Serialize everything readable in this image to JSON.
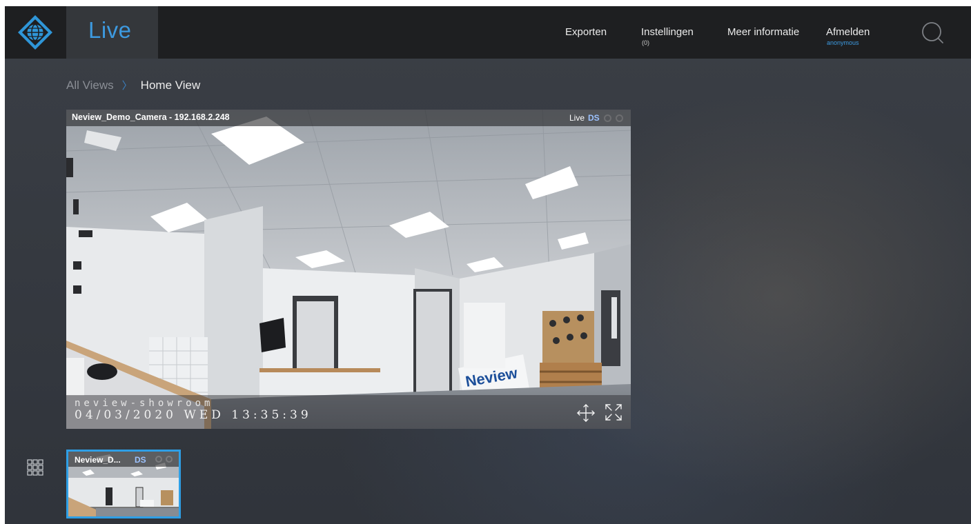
{
  "header": {
    "app_tab": "Live",
    "nav": [
      {
        "label": "Exporten",
        "sub": ""
      },
      {
        "label": "Instellingen",
        "sub": "(0)"
      },
      {
        "label": "Meer informatie",
        "sub": ""
      },
      {
        "label": "Afmelden",
        "sub": "anonymous"
      }
    ]
  },
  "breadcrumb": {
    "root": "All Views",
    "separator": "〉",
    "current": "Home View"
  },
  "camera": {
    "title": "Neview_Demo_Camera - 192.168.2.248",
    "mode": "Live",
    "stream_badge": "DS",
    "osd_name": "neview-showroom",
    "osd_timestamp": "04/03/2020 WED 13:35:39",
    "sign_text": "Neview"
  },
  "thumbnail": {
    "title": "Neview_D...",
    "stream_badge": "DS"
  },
  "icons": {
    "logo": "globe-diamond-logo",
    "search": "search-icon",
    "ptz": "move-arrows-icon",
    "fullscreen": "fullscreen-icon",
    "layout": "grid-icon"
  },
  "colors": {
    "accent": "#3d9ae0",
    "topbar": "#1e1f21",
    "live_tab": "#34373b",
    "selected_border": "#2e9fe6",
    "badge": "#9cc2ff"
  }
}
